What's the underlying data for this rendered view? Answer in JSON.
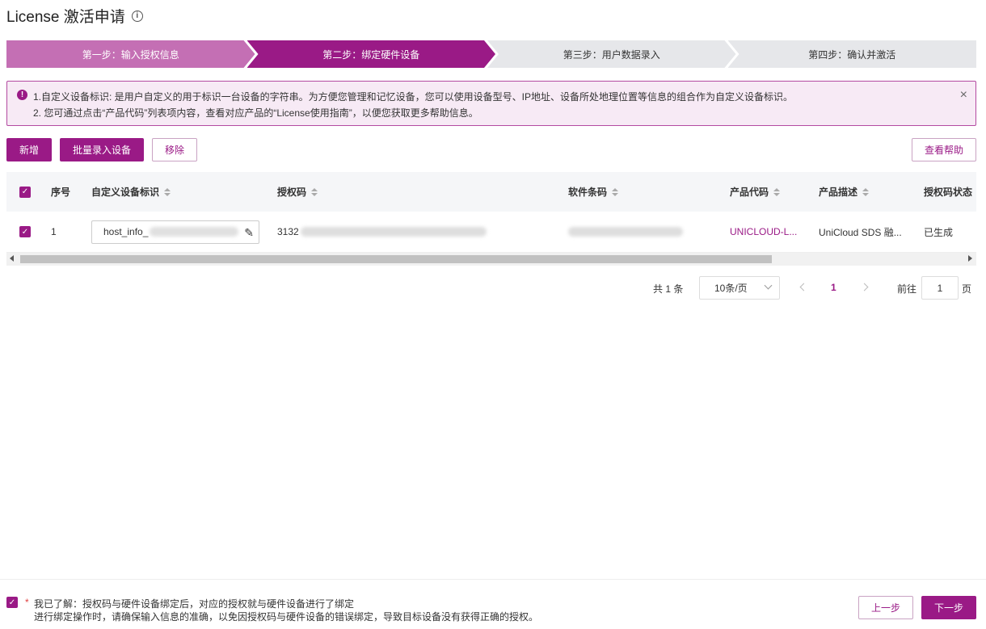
{
  "page": {
    "title": "License 激活申请",
    "info_icon": "i"
  },
  "steps": [
    {
      "label": "第一步：输入授权信息",
      "state": "done"
    },
    {
      "label": "第二步：绑定硬件设备",
      "state": "active"
    },
    {
      "label": "第三步：用户数据录入",
      "state": "pending"
    },
    {
      "label": "第四步：确认并激活",
      "state": "pending"
    }
  ],
  "notice": {
    "line1": "1.自定义设备标识: 是用户自定义的用于标识一台设备的字符串。为方便您管理和记忆设备，您可以使用设备型号、IP地址、设备所处地理位置等信息的组合作为自定义设备标识。",
    "line2": "2. 您可通过点击“产品代码”列表项内容，查看对应产品的“License使用指南”，以便您获取更多帮助信息。",
    "icon": "!",
    "close": "×"
  },
  "toolbar": {
    "add": "新增",
    "batch": "批量录入设备",
    "remove": "移除",
    "help": "查看帮助"
  },
  "table": {
    "headers": {
      "index": "序号",
      "device_id": "自定义设备标识",
      "auth_code": "授权码",
      "sw_barcode": "软件条码",
      "product_code": "产品代码",
      "product_desc": "产品描述",
      "auth_status": "授权码状态"
    },
    "rows": [
      {
        "index": "1",
        "device_id": "host_info_",
        "auth_code": "3132",
        "product_code": "UNICLOUD-L...",
        "product_desc": "UniCloud SDS 融...",
        "auth_status": "已生成"
      }
    ]
  },
  "pagination": {
    "total": "共 1 条",
    "page_size": "10条/页",
    "current": "1",
    "goto_label": "前往",
    "goto_value": "1",
    "page_unit": "页"
  },
  "footer": {
    "required_mark": "*",
    "line1": "我已了解：授权码与硬件设备绑定后，对应的授权就与硬件设备进行了绑定",
    "line2": "进行绑定操作时，请确保输入信息的准确，以免因授权码与硬件设备的错误绑定，导致目标设备没有获得正确的授权。",
    "prev": "上一步",
    "next": "下一步"
  },
  "colors": {
    "brand": "#9a1a86",
    "step_done": "#c46fb4",
    "step_pending": "#e6e7ea"
  }
}
